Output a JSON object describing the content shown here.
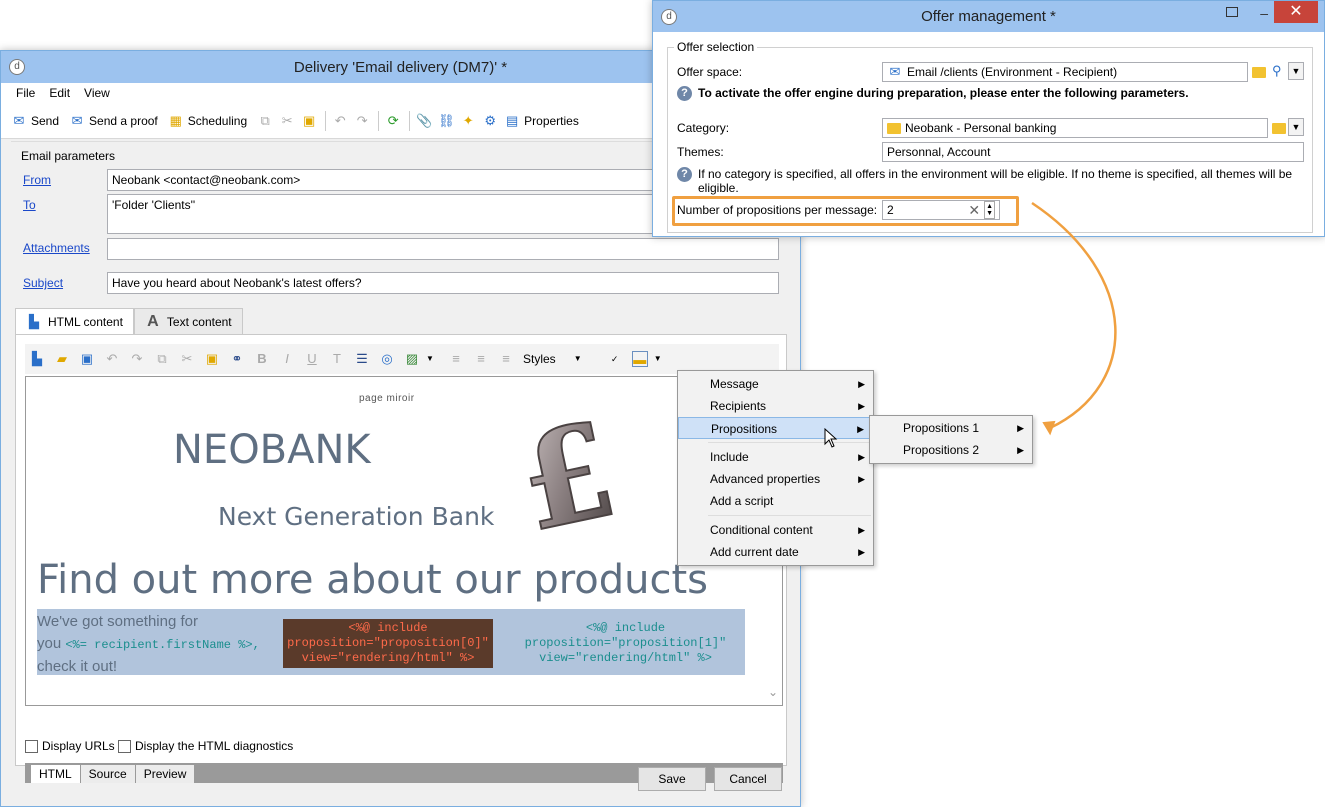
{
  "delivery_window": {
    "title": "Delivery 'Email delivery (DM7)' *",
    "menu": [
      "File",
      "Edit",
      "View"
    ],
    "toolbar": {
      "send": "Send",
      "send_proof": "Send a proof",
      "scheduling": "Scheduling",
      "properties": "Properties"
    },
    "email_params": {
      "section_title": "Email parameters",
      "from_label": "From",
      "from_value": "Neobank <contact@neobank.com>",
      "to_label": "To",
      "to_value": "'Folder 'Clients''",
      "attachments_label": "Attachments",
      "attachments_value": "",
      "subject_label": "Subject",
      "subject_value": "Have you heard about Neobank's latest offers?"
    },
    "tabs": {
      "html": "HTML content",
      "text": "Text content"
    },
    "editor": {
      "styles_label": "Styles",
      "content": {
        "mirror": "page miroir",
        "neobank": "NEOBANK",
        "next_gen": "Next Generation Bank",
        "find_out": "Find out more about our products",
        "line1": "We've got something for",
        "line2_prefix": "you ",
        "line2_code": "<%= recipient.firstName %>,",
        "line3": "check it out!",
        "code1_l1": "<%@ include",
        "code1_l2": "proposition=\"proposition[0]\"",
        "code1_l3": "view=\"rendering/html\" %>",
        "code2_l1": "<%@ include",
        "code2_l2": "proposition=\"proposition[1]\"",
        "code2_l3": "view=\"rendering/html\" %>"
      },
      "modes": [
        "HTML",
        "Source",
        "Preview"
      ]
    },
    "checkboxes": {
      "display_urls": "Display URLs",
      "display_diag": "Display the HTML diagnostics"
    },
    "buttons": {
      "save": "Save",
      "cancel": "Cancel"
    }
  },
  "offer_window": {
    "title": "Offer management *",
    "close": "✕",
    "section_title": "Offer selection",
    "offer_space_label": "Offer space:",
    "offer_space_value": "Email /clients (Environment - Recipient)",
    "activate_hint": "To activate the offer engine during preparation, please enter the following parameters.",
    "category_label": "Category:",
    "category_value": "Neobank - Personal banking",
    "themes_label": "Themes:",
    "themes_value": "Personnal, Account",
    "eligible_hint": "If no category is specified, all offers in the environment will be eligible. If no theme is specified, all themes will be eligible.",
    "propositions_label": "Number of propositions per message:",
    "propositions_value": "2"
  },
  "context_menu": {
    "items": [
      {
        "label": "Message",
        "submenu": true
      },
      {
        "label": "Recipients",
        "submenu": true
      },
      {
        "label": "Propositions",
        "submenu": true,
        "highlighted": true
      },
      {
        "label": "Include",
        "submenu": true
      },
      {
        "label": "Advanced properties",
        "submenu": true
      },
      {
        "label": "Add a script",
        "submenu": false
      },
      {
        "label": "Conditional content",
        "submenu": true
      },
      {
        "label": "Add current date",
        "submenu": true
      }
    ],
    "submenu": [
      "Propositions 1",
      "Propositions 2"
    ]
  },
  "colors": {
    "titlebar": "#9dc3ef",
    "highlight_annotation": "#f0a040",
    "link": "#1a48c9"
  }
}
